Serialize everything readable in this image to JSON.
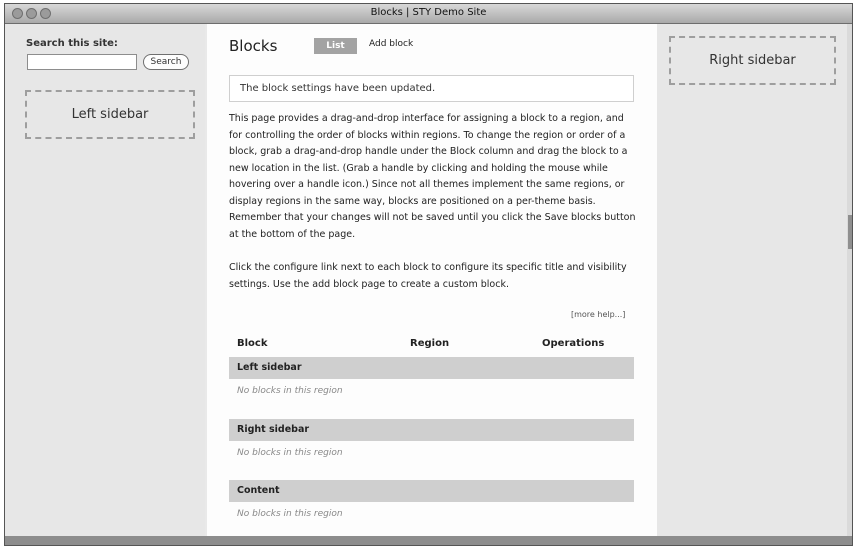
{
  "window": {
    "title": "Blocks | STY Demo Site"
  },
  "search": {
    "label": "Search this site:",
    "value": "",
    "button": "Search"
  },
  "left_region": {
    "label": "Left sidebar"
  },
  "right_region": {
    "label": "Right sidebar"
  },
  "main": {
    "title": "Blocks",
    "tabs": [
      {
        "label": "List",
        "active": true
      },
      {
        "label": "Add block",
        "active": false
      }
    ],
    "status_message": "The block settings have been updated.",
    "help_text_1": "This page provides a drag-and-drop interface for assigning a block to a region, and for controlling the order of blocks within regions. To change the region or order of a block, grab a drag-and-drop handle under the Block column and drag the block to a new location in the list. (Grab a handle by clicking and holding the mouse while hovering over a handle icon.) Since not all themes implement the same regions, or display regions in the same way, blocks are positioned on a per-theme basis. Remember that your changes will not be saved until you click the Save blocks button at the bottom of the page.",
    "help_text_2": "Click the configure link next to each block to configure its specific title and visibility settings. Use the add block page to create a custom block.",
    "more_help": "[more help...]",
    "table": {
      "headers": [
        "Block",
        "Region",
        "Operations"
      ],
      "regions": [
        {
          "name": "Left sidebar",
          "empty_text": "No blocks in this region"
        },
        {
          "name": "Right sidebar",
          "empty_text": "No blocks in this region"
        },
        {
          "name": "Content",
          "empty_text": "No blocks in this region"
        }
      ]
    }
  }
}
